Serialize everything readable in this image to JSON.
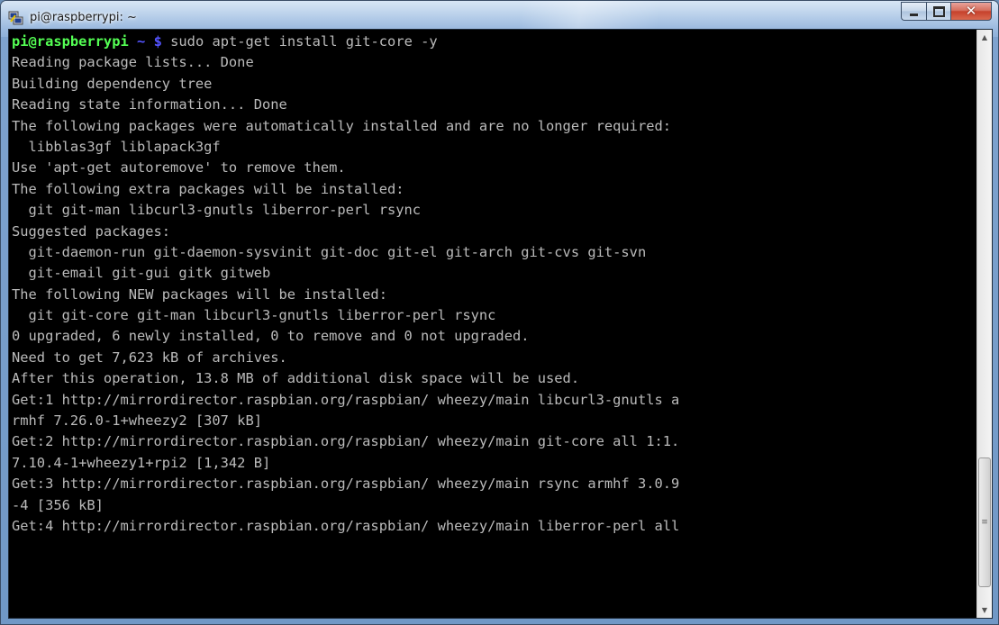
{
  "window": {
    "title": "pi@raspberrypi: ~",
    "buttons": {
      "minimize": "minimize",
      "maximize": "maximize",
      "close": "close"
    }
  },
  "icons": {
    "app": "putty-icon",
    "minimize": "minimize-icon",
    "maximize": "maximize-icon",
    "close": "close-icon",
    "scroll_up": "scroll-up-arrow-icon",
    "scroll_down": "scroll-down-arrow-icon"
  },
  "terminal": {
    "prompt": {
      "user_host": "pi@raspberrypi",
      "path": "~",
      "symbol": "$",
      "command": "sudo apt-get install git-core -y"
    },
    "lines": [
      "Reading package lists... Done",
      "Building dependency tree",
      "Reading state information... Done",
      "The following packages were automatically installed and are no longer required:",
      "  libblas3gf liblapack3gf",
      "Use 'apt-get autoremove' to remove them.",
      "The following extra packages will be installed:",
      "  git git-man libcurl3-gnutls liberror-perl rsync",
      "Suggested packages:",
      "  git-daemon-run git-daemon-sysvinit git-doc git-el git-arch git-cvs git-svn",
      "  git-email git-gui gitk gitweb",
      "The following NEW packages will be installed:",
      "  git git-core git-man libcurl3-gnutls liberror-perl rsync",
      "0 upgraded, 6 newly installed, 0 to remove and 0 not upgraded.",
      "Need to get 7,623 kB of archives.",
      "After this operation, 13.8 MB of additional disk space will be used.",
      "Get:1 http://mirrordirector.raspbian.org/raspbian/ wheezy/main libcurl3-gnutls a",
      "rmhf 7.26.0-1+wheezy2 [307 kB]",
      "Get:2 http://mirrordirector.raspbian.org/raspbian/ wheezy/main git-core all 1:1.",
      "7.10.4-1+wheezy1+rpi2 [1,342 B]",
      "Get:3 http://mirrordirector.raspbian.org/raspbian/ wheezy/main rsync armhf 3.0.9",
      "-4 [356 kB]",
      "Get:4 http://mirrordirector.raspbian.org/raspbian/ wheezy/main liberror-perl all"
    ]
  },
  "colors": {
    "background": "#000000",
    "text": "#bbbbbb",
    "prompt_user": "#54ff54",
    "prompt_path": "#5454ff",
    "titlebar": "#9dbbe0",
    "close_button": "#c6412c"
  }
}
